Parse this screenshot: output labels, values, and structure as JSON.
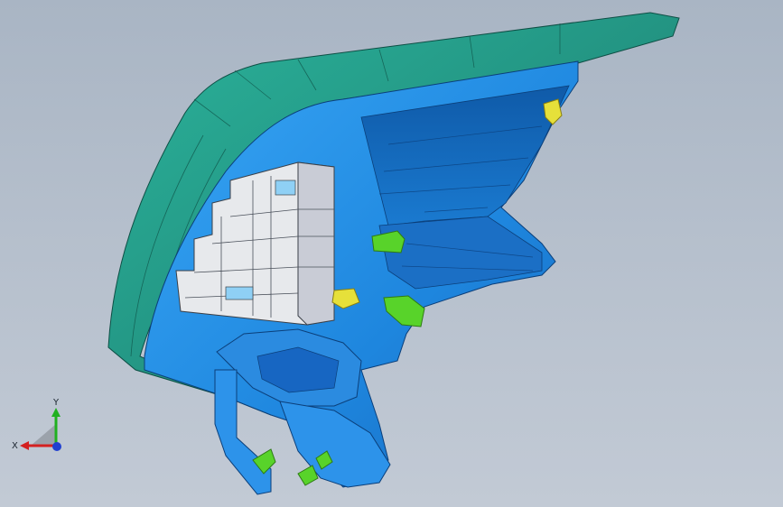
{
  "viewport": {
    "background_top": "#a9b5c4",
    "background_bottom": "#c2cad5"
  },
  "model": {
    "housing_color": "#2a9d8a",
    "body_color": "#1f8fe6",
    "bracket_color": "#e7e9ec",
    "connector_color": "#58d32a",
    "bulb_color": "#e6e03a"
  },
  "triad": {
    "x_label": "X",
    "y_label": "Y",
    "x_color": "#d42020",
    "y_color": "#20b020",
    "z_color": "#2040d0"
  }
}
